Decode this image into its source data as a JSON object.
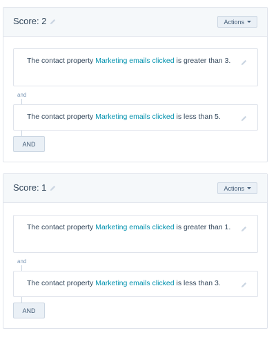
{
  "groups": [
    {
      "score_label": "Score: 2",
      "actions_label": "Actions",
      "rules": [
        {
          "prefix": "The contact property ",
          "property": "Marketing emails clicked",
          "suffix": " is greater than 3."
        },
        {
          "prefix": "The contact property ",
          "property": "Marketing emails clicked",
          "suffix": " is less than 5."
        }
      ],
      "connector": "and",
      "add_and_label": "AND"
    },
    {
      "score_label": "Score: 1",
      "actions_label": "Actions",
      "rules": [
        {
          "prefix": "The contact property ",
          "property": "Marketing emails clicked",
          "suffix": " is greater than 1."
        },
        {
          "prefix": "The contact property ",
          "property": "Marketing emails clicked",
          "suffix": " is less than 3."
        }
      ],
      "connector": "and",
      "add_and_label": "AND"
    }
  ],
  "colors": {
    "link": "#0091ae",
    "header_bg": "#f5f8fa",
    "border": "#dfe3eb"
  },
  "icons": {
    "edit": "pencil-icon",
    "dropdown": "caret-down-icon"
  }
}
